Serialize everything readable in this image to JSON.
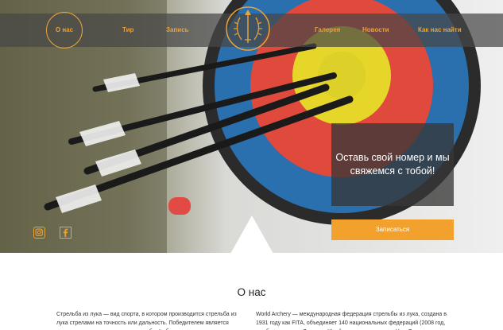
{
  "nav": {
    "items": [
      "О нас",
      "Тир",
      "Запись",
      "Галерея",
      "Новости",
      "Как нас найти"
    ],
    "active": "О нас"
  },
  "hero": {
    "callout_text": "Оставь свой номер и мы свяжемся с тобой!",
    "signup_label": "Записаться"
  },
  "social": {
    "icons": [
      "instagram-icon",
      "facebook-icon"
    ]
  },
  "about": {
    "title": "О нас",
    "left_text": "Стрельба из лука — вид спорта, в котором производится стрельба из лука стрелами на точность или дальность. Победителем является спортсмен или команда, которая наберёт больше очков, согласно",
    "right_text": "World Archery — международная федерация стрельбы из лука, создана в 1931 году как FITA, объединяет 140 национальных федераций (2008 год, штаб-квартира — Лозанна, Швейцария, президент — Угур Эрденер"
  },
  "colors": {
    "accent": "#e8a33a",
    "button": "#f2a22c",
    "navbar": "#464646"
  }
}
